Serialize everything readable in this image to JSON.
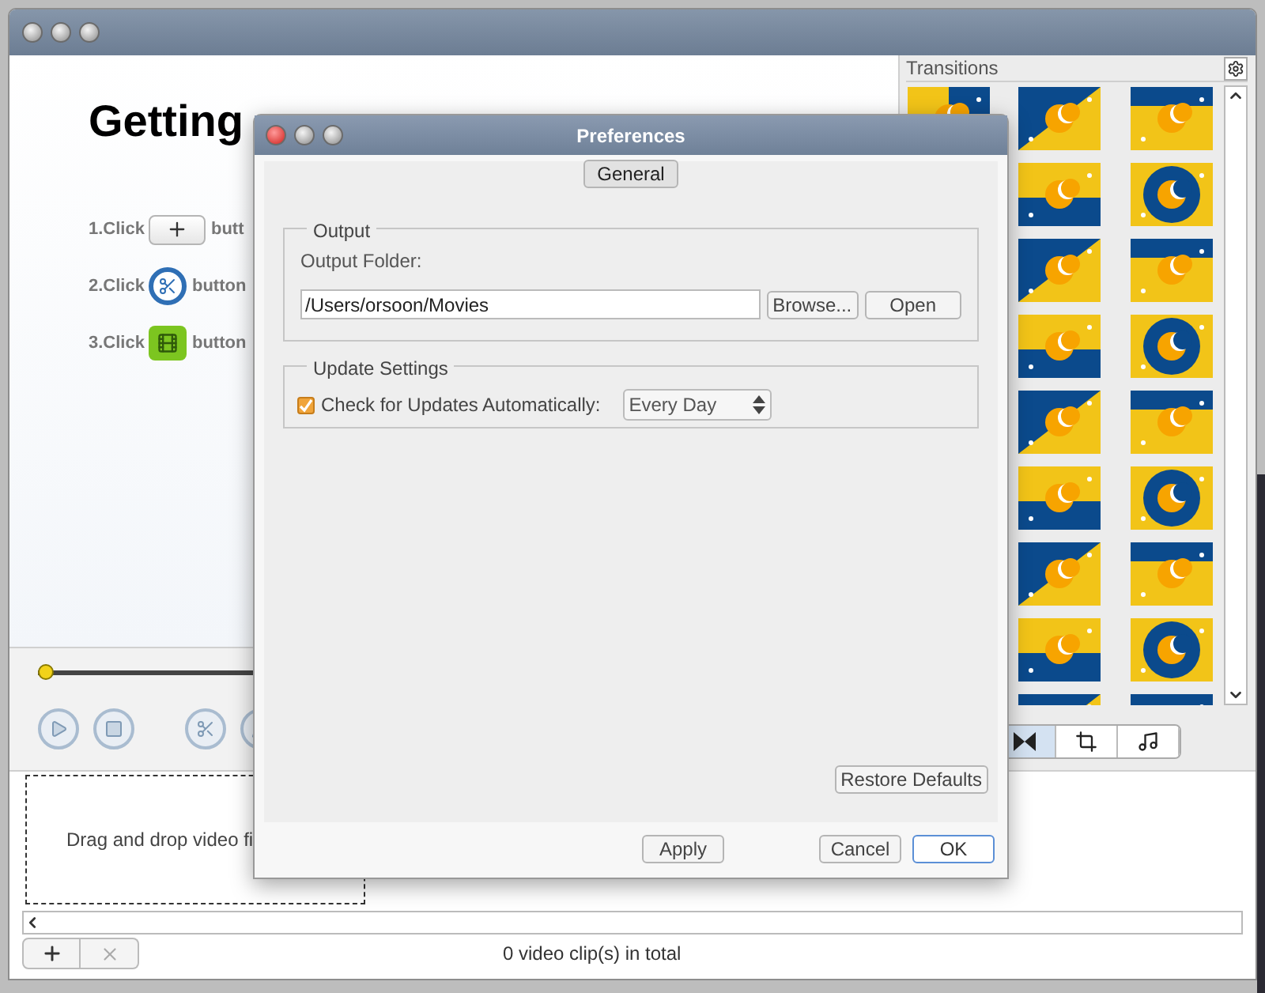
{
  "main_window": {
    "heading": "Getting",
    "steps": [
      {
        "label": "1.Click",
        "kind": "plus",
        "after": "butt"
      },
      {
        "label": "2.Click",
        "kind": "scissors",
        "after": "button"
      },
      {
        "label": "3.Click",
        "kind": "film",
        "after": "button"
      }
    ],
    "timeline": {
      "level": 0
    },
    "drop_zone": {
      "text": "Drag and drop video fi"
    },
    "status_bar": {
      "text": "0 video clip(s) in total"
    }
  },
  "transitions": {
    "title": "Transitions",
    "tabs": [
      {
        "kind": "transition",
        "selected": true
      },
      {
        "kind": "crop",
        "selected": false
      },
      {
        "kind": "audio",
        "selected": false
      }
    ]
  },
  "preferences": {
    "title": "Preferences",
    "tabs": [
      {
        "label": "General",
        "selected": true
      }
    ],
    "output": {
      "legend": "Output",
      "folder_label": "Output Folder:",
      "folder_value": "/Users/orsoon/Movies",
      "browse_button": "Browse...",
      "open_button": "Open"
    },
    "updates": {
      "legend": "Update Settings",
      "check_label": "Check for Updates Automatically:",
      "checked": true,
      "frequency": "Every Day"
    },
    "restore_button": "Restore Defaults",
    "buttons": [
      {
        "label": "Apply",
        "default": false
      },
      {
        "label": "Cancel",
        "default": false
      },
      {
        "label": "OK",
        "default": true
      }
    ]
  }
}
